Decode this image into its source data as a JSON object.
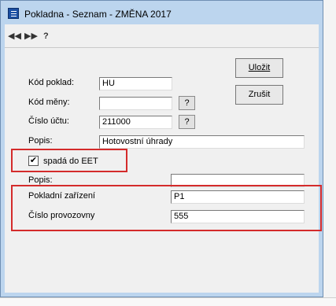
{
  "window": {
    "title": "Pokladna - Seznam  - ZMĚNA 2017"
  },
  "toolbar": {
    "first_glyph": "◀◀",
    "prev_glyph": "▶▶",
    "help_label": "?"
  },
  "form": {
    "kod_pokladny_label": "Kód poklad:",
    "kod_pokladny_value": "HU",
    "kod_meny_label": "Kód měny:",
    "kod_meny_value": "",
    "cislo_uctu_label": "Číslo účtu:",
    "cislo_uctu_value": "211000",
    "popis_label": "Popis:",
    "popis_value": "Hotovostní úhrady",
    "lookup_label": "?",
    "eet_checkbox_label": "spadá do EET",
    "eet_checked": "✔",
    "popis2_label": "Popis:",
    "popis2_value": "",
    "pokladni_zarizeni_label": "Pokladní zařízení",
    "pokladni_zarizeni_value": "P1",
    "cislo_provozovny_label": "Číslo provozovny",
    "cislo_provozovny_value": "555"
  },
  "buttons": {
    "save_label": "Uložit",
    "cancel_label": "Zrušit"
  },
  "colors": {
    "window_frame": "#bcd5ee",
    "client_bg": "#f0f0f0",
    "highlight": "#d42b2b"
  }
}
